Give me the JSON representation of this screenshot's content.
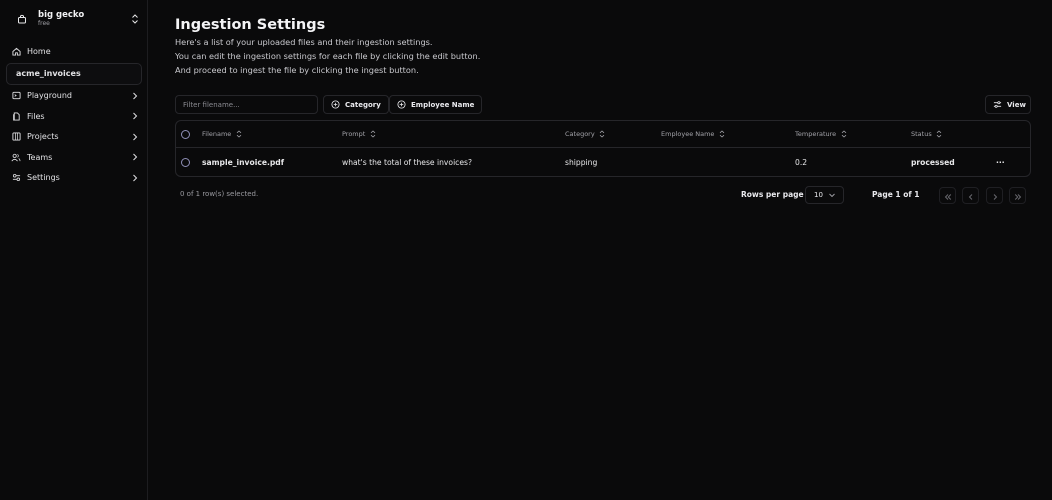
{
  "org": {
    "name": "big gecko",
    "plan": "free"
  },
  "sidebar": {
    "items": [
      {
        "label": "Home",
        "icon": "home-icon"
      },
      {
        "label": "acme_invoices",
        "icon": ""
      },
      {
        "label": "Playground",
        "icon": "terminal-icon"
      },
      {
        "label": "Files",
        "icon": "files-icon"
      },
      {
        "label": "Projects",
        "icon": "projects-icon"
      },
      {
        "label": "Teams",
        "icon": "users-icon"
      },
      {
        "label": "Settings",
        "icon": "settings-icon"
      }
    ]
  },
  "page": {
    "title": "Ingestion Settings",
    "desc1": "Here's a list of your uploaded files and their ingestion settings.",
    "desc2": "You can edit the ingestion settings for each file by clicking the edit button.",
    "desc3": "And proceed to ingest the file by clicking the ingest button."
  },
  "toolbar": {
    "filter_placeholder": "Filter filename...",
    "category_label": "Category",
    "employee_label": "Employee Name",
    "view_label": "View"
  },
  "table": {
    "headers": {
      "filename": "Filename",
      "prompt": "Prompt",
      "category": "Category",
      "employee": "Employee Name",
      "temperature": "Temperature",
      "status": "Status"
    },
    "rows": [
      {
        "filename": "sample_invoice.pdf",
        "prompt": "what's the total of these invoices?",
        "category": "shipping",
        "employee": "",
        "temperature": "0.2",
        "status": "processed",
        "actions": "···"
      }
    ]
  },
  "footer": {
    "selection": "0 of 1 row(s) selected.",
    "rows_per_page_label": "Rows per page",
    "rows_per_page_value": "10",
    "page_label": "Page 1 of 1"
  },
  "colors": {
    "background": "#0a0a0b",
    "border": "#26262a",
    "text": "#e8e8ea",
    "muted": "#a3a3a9"
  }
}
